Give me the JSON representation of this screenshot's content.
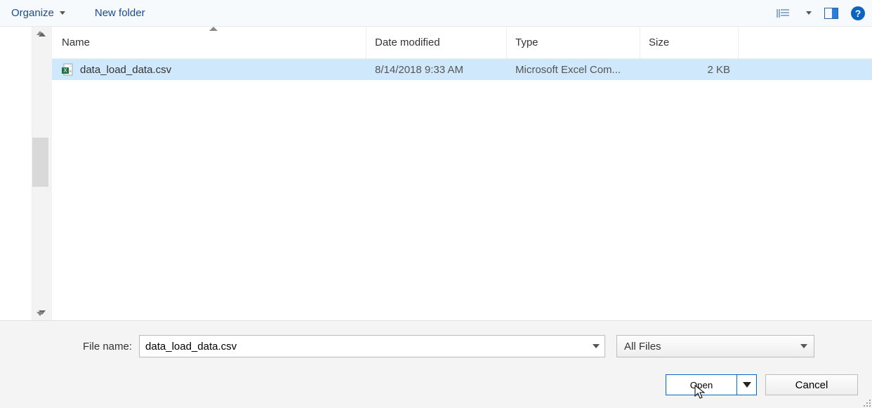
{
  "toolbar": {
    "organize_label": "Organize",
    "new_folder_label": "New folder"
  },
  "columns": {
    "name": "Name",
    "date": "Date modified",
    "type": "Type",
    "size": "Size"
  },
  "files": [
    {
      "icon": "excel-csv-icon",
      "name": "data_load_data.csv",
      "date": "8/14/2018 9:33 AM",
      "type": "Microsoft Excel Com...",
      "size": "2 KB",
      "selected": true
    }
  ],
  "footer": {
    "file_name_label": "File name:",
    "file_name_value": "data_load_data.csv",
    "filter_value": "All Files",
    "open_label": "Open",
    "cancel_label": "Cancel"
  }
}
